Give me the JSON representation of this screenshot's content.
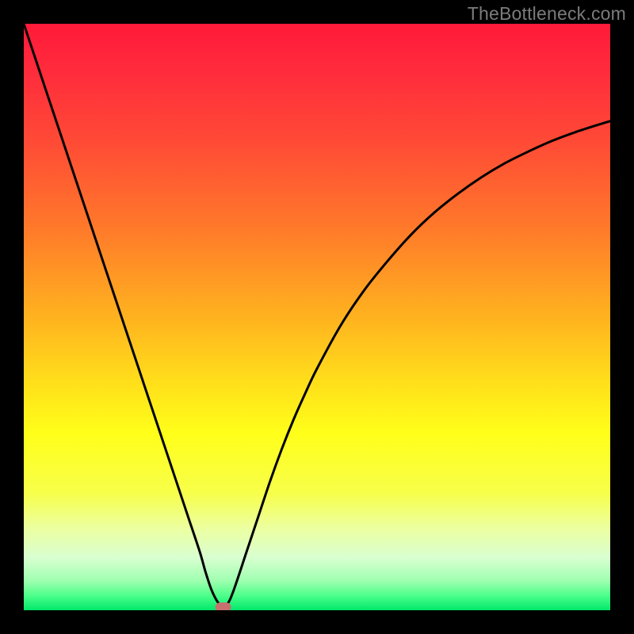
{
  "watermark": "TheBottleneck.com",
  "chart_data": {
    "type": "line",
    "title": "",
    "xlabel": "",
    "ylabel": "",
    "xlim": [
      0,
      100
    ],
    "ylim": [
      0,
      100
    ],
    "series": [
      {
        "name": "bottleneck-curve",
        "x": [
          0,
          2,
          4,
          6,
          8,
          10,
          12,
          14,
          16,
          18,
          20,
          22,
          24,
          26,
          28,
          30,
          31,
          32,
          33,
          34,
          35,
          36,
          38,
          40,
          42,
          44,
          46,
          48,
          50,
          54,
          58,
          62,
          66,
          70,
          74,
          78,
          82,
          86,
          90,
          94,
          98,
          100
        ],
        "y": [
          100,
          94,
          88,
          82,
          76,
          70,
          64,
          58,
          52,
          46,
          40,
          34,
          28,
          22,
          16,
          10,
          6.5,
          3.5,
          1.5,
          0.5,
          1.5,
          4,
          10,
          16,
          22,
          27.5,
          32.5,
          37,
          41.2,
          48.5,
          54.5,
          59.5,
          64,
          67.8,
          71,
          73.8,
          76.2,
          78.2,
          80,
          81.5,
          82.8,
          83.4
        ]
      }
    ],
    "marker": {
      "x": 34,
      "y": 0.5,
      "shape": "pill",
      "color": "#c86f6f"
    },
    "gradient_stops": [
      {
        "offset": 0.0,
        "color": "#ff1a3a"
      },
      {
        "offset": 0.08,
        "color": "#ff2b3c"
      },
      {
        "offset": 0.2,
        "color": "#ff4a36"
      },
      {
        "offset": 0.35,
        "color": "#ff7a2a"
      },
      {
        "offset": 0.5,
        "color": "#ffb21f"
      },
      {
        "offset": 0.62,
        "color": "#ffe21a"
      },
      {
        "offset": 0.7,
        "color": "#ffff1a"
      },
      {
        "offset": 0.8,
        "color": "#f7ff4a"
      },
      {
        "offset": 0.86,
        "color": "#ecffa0"
      },
      {
        "offset": 0.91,
        "color": "#d9ffd0"
      },
      {
        "offset": 0.95,
        "color": "#9effb0"
      },
      {
        "offset": 0.975,
        "color": "#4dff8a"
      },
      {
        "offset": 1.0,
        "color": "#00e86a"
      }
    ]
  }
}
